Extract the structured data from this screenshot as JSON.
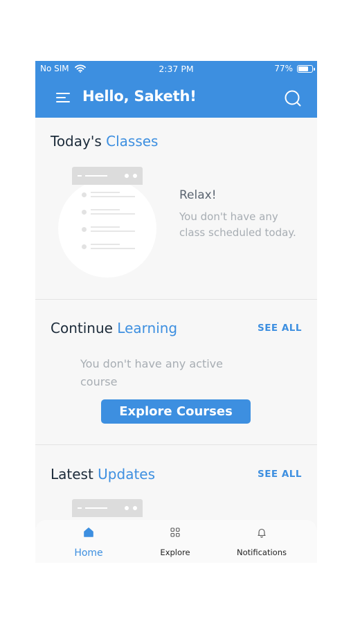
{
  "status_bar": {
    "carrier": "No SIM",
    "time": "2:37 PM",
    "battery": "77%",
    "battery_level": 0.77
  },
  "header": {
    "greeting": "Hello, Saketh!"
  },
  "todays_classes": {
    "title_plain": "Today's ",
    "title_accent": "Classes",
    "empty_title": "Relax!",
    "empty_text": "You don't have any class scheduled today."
  },
  "continue_learning": {
    "title_plain": "Continue ",
    "title_accent": "Learning",
    "see_all": "SEE ALL",
    "empty_text": "You don't have any active course",
    "cta": "Explore Courses"
  },
  "latest_updates": {
    "title_plain": "Latest ",
    "title_accent": "Updates",
    "see_all": "SEE ALL"
  },
  "tabs": [
    {
      "label": "Home",
      "icon": "home-icon",
      "active": true
    },
    {
      "label": "Explore",
      "icon": "grid-icon",
      "active": false
    },
    {
      "label": "Notifications",
      "icon": "bell-icon",
      "active": false
    }
  ],
  "colors": {
    "primary": "#3d8fe0",
    "heading": "#1c2b3a",
    "muted": "#a7adb3",
    "background": "#f7f7f7"
  }
}
